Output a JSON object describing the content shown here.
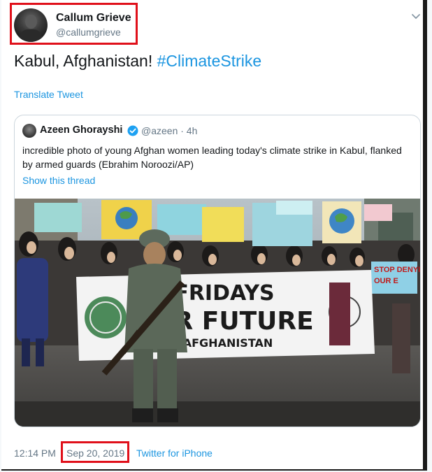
{
  "author": {
    "name": "Callum Grieve",
    "handle": "@callumgrieve"
  },
  "tweet": {
    "text": "Kabul, Afghanistan! ",
    "hashtag": "#ClimateStrike",
    "translate_label": "Translate Tweet"
  },
  "quoted": {
    "name": "Azeen Ghorayshi",
    "handle": "@azeen · 4h",
    "text": "incredible photo of young Afghan women leading today's climate strike in Kabul, flanked by armed guards (Ebrahim Noroozi/AP)",
    "thread_link": "Show this thread",
    "photo_banner": {
      "line1": "FRIDAYS",
      "line2": "FOR FUTURE",
      "line3": "AFGHANISTAN"
    }
  },
  "meta": {
    "time": "12:14 PM",
    "date": "Sep 20, 2019",
    "source": "Twitter for iPhone"
  },
  "colors": {
    "link": "#1b95e0",
    "highlight": "#e0101a",
    "verified": "#1da1f2"
  }
}
